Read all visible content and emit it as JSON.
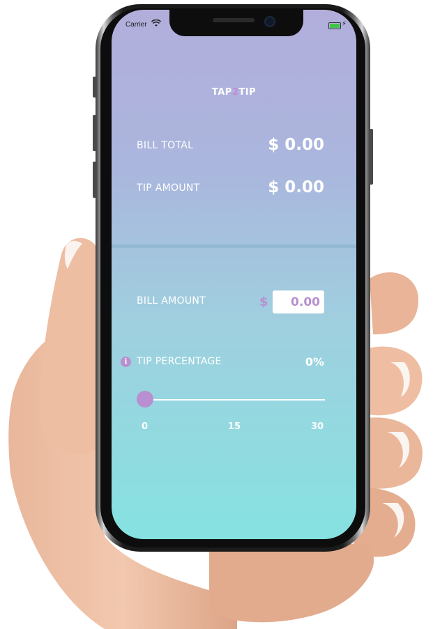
{
  "status_bar": {
    "carrier": "Carrier",
    "wifi_icon": "wifi-icon",
    "battery_icon": "battery-icon"
  },
  "app": {
    "title_part1": "TAP",
    "title_part2": "2",
    "title_part3": "TIP"
  },
  "summary": {
    "bill_total_label": "BILL TOTAL",
    "bill_total_value": "$ 0.00",
    "tip_amount_label": "TIP AMOUNT",
    "tip_amount_value": "$ 0.00"
  },
  "inputs": {
    "bill_amount_label": "BILL AMOUNT",
    "currency_symbol": "$",
    "bill_amount_value": "0.00",
    "tip_percentage_label": "TIP PERCENTAGE",
    "tip_percentage_value": "0%",
    "info_icon": "info-icon",
    "slider": {
      "min": 0,
      "max": 30,
      "value": 0,
      "ticks": [
        "0",
        "15",
        "30"
      ]
    }
  },
  "colors": {
    "accent": "#b88fd0",
    "gradient_top": "#b2aedb",
    "gradient_bottom": "#86e2e1"
  }
}
